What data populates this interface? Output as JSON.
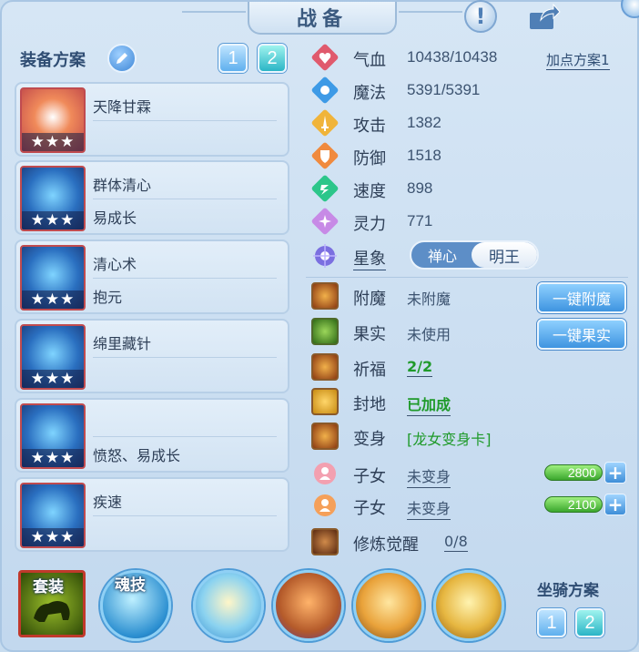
{
  "title": "战备",
  "equipment": {
    "label": "装备方案",
    "plans": [
      "1",
      "2"
    ],
    "active_plan": "2",
    "items": [
      {
        "line1": "天降甘霖",
        "line2": "",
        "stars": "★★★"
      },
      {
        "line1": "群体清心",
        "line2": "易成长",
        "stars": "★★★"
      },
      {
        "line1": "清心术",
        "line2": "抱元",
        "stars": "★★★"
      },
      {
        "line1": "绵里藏针",
        "line2": "",
        "stars": "★★★"
      },
      {
        "line1": "",
        "line2": "愤怒、易成长",
        "stars": "★★★"
      },
      {
        "line1": "疾速",
        "line2": "",
        "stars": "★★★"
      }
    ]
  },
  "stats": {
    "add_plan": "加点方案1",
    "rows": [
      {
        "name": "气血",
        "value": "10438/10438"
      },
      {
        "name": "魔法",
        "value": "5391/5391"
      },
      {
        "name": "攻击",
        "value": "1382"
      },
      {
        "name": "防御",
        "value": "1518"
      },
      {
        "name": "速度",
        "value": "898"
      },
      {
        "name": "灵力",
        "value": "771"
      }
    ],
    "xingxiang": {
      "name": "星象",
      "options": [
        "禅心",
        "明王"
      ],
      "selected": "明王"
    }
  },
  "extras": {
    "fumo": {
      "name": "附魔",
      "value": "未附魔",
      "button": "一键附魔"
    },
    "guoshi": {
      "name": "果实",
      "value": "未使用",
      "button": "一键果实"
    },
    "qifu": {
      "name": "祈福",
      "value": "2/2"
    },
    "fengdi": {
      "name": "封地",
      "value": "已加成"
    },
    "bianshen": {
      "name": "变身",
      "value": "[龙女变身卡]"
    },
    "zinv1": {
      "name": "子女",
      "value": "未变身",
      "bar": "2800"
    },
    "zinv2": {
      "name": "子女",
      "value": "未变身",
      "bar": "2100"
    },
    "xiulian": {
      "name": "修炼觉醒",
      "value": "0/8"
    }
  },
  "bottom": {
    "taozhuang": "套装",
    "hunji": "魂技",
    "mount_label": "坐骑方案",
    "mount_plans": [
      "1",
      "2"
    ]
  },
  "colors": {
    "accent": "#3e94e0",
    "green": "#1f9a2a",
    "panel": "#c7dcef"
  }
}
